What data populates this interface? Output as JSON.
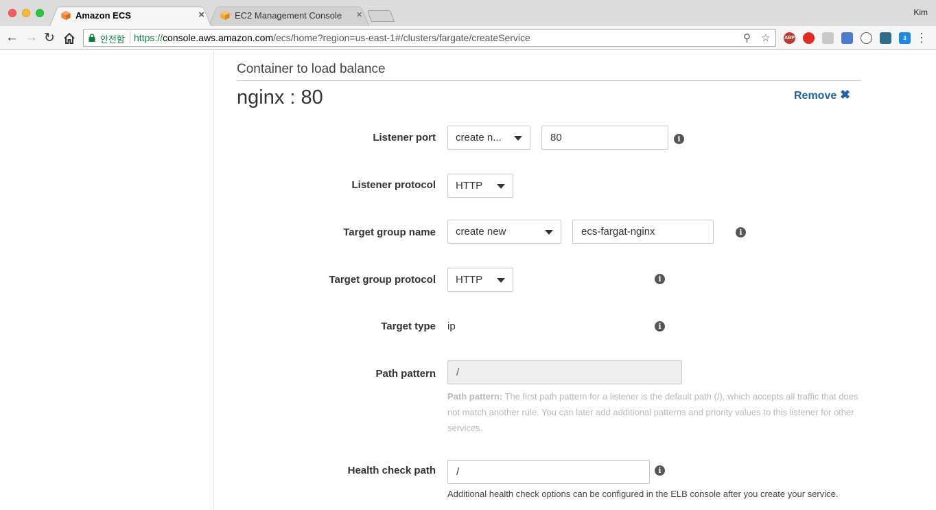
{
  "browser": {
    "tabs": [
      {
        "label": "Amazon ECS",
        "active": true,
        "favicon_color": "#f58536"
      },
      {
        "label": "EC2 Management Console",
        "active": false,
        "favicon_color": "#f7a833"
      }
    ],
    "close_glyph": "×",
    "user": "Kim",
    "secure_label": "안전함",
    "url_scheme": "https://",
    "url_host": "console.aws.amazon.com",
    "url_path": "/ecs/home?region=us-east-1#/clusters/fargate/createService",
    "extensions": [
      "ABP",
      "",
      "",
      "",
      "",
      "",
      "3"
    ]
  },
  "section": {
    "title": "Container to load balance",
    "container_name": "nginx : 80",
    "remove_label": "Remove",
    "remove_glyph": "✖"
  },
  "form": {
    "listener_port": {
      "label": "Listener port",
      "select_value": "create n...",
      "input_value": "80"
    },
    "listener_protocol": {
      "label": "Listener protocol",
      "select_value": "HTTP"
    },
    "target_group_name": {
      "label": "Target group name",
      "select_value": "create new",
      "input_value": "ecs-fargat-nginx"
    },
    "target_group_protocol": {
      "label": "Target group protocol",
      "select_value": "HTTP"
    },
    "target_type": {
      "label": "Target type",
      "value": "ip"
    },
    "path_pattern": {
      "label": "Path pattern",
      "input_value": "/",
      "help_lead": "Path pattern:",
      "help_text": " The first path pattern for a listener is the default path (/), which accepts all traffic that does not match another rule. You can later add additional patterns and priority values to this listener for other services."
    },
    "health_check_path": {
      "label": "Health check path",
      "input_value": "/",
      "help_text": "Additional health check options can be configured in the ELB console after you create your service."
    },
    "info_glyph": "i"
  }
}
